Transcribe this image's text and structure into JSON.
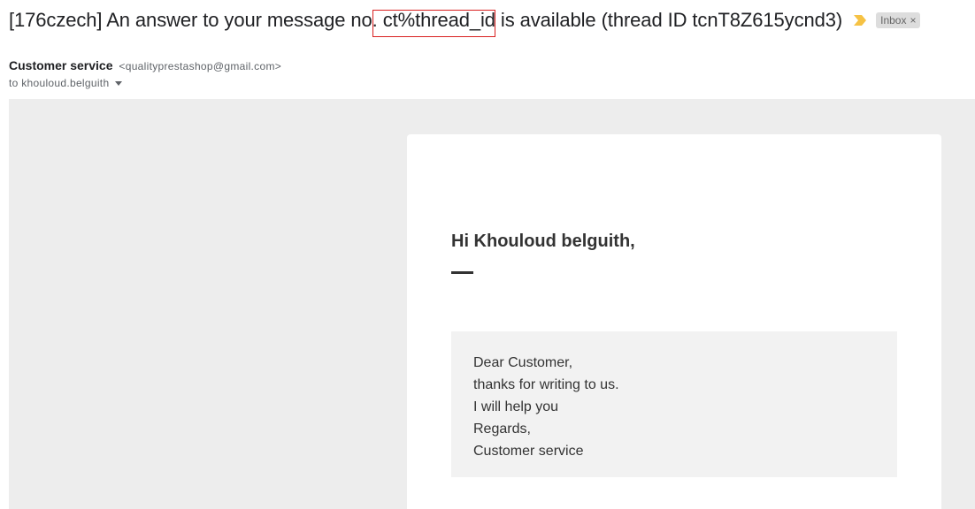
{
  "header": {
    "subject": "[176czech] An answer to your message no. ct%thread_id is available (thread ID tcnT8Z615ycnd3)",
    "important_icon": "important-marker-icon",
    "label": "Inbox",
    "label_remove": "×",
    "colors": {
      "highlight_border": "#d92020",
      "important_marker": "#f6c244",
      "label_bg": "#dddddd"
    }
  },
  "sender": {
    "name": "Customer service",
    "email": "<qualityprestashop@gmail.com>",
    "to": "to khouloud.belguith"
  },
  "body": {
    "greeting": "Hi Khouloud belguith,",
    "message_lines": [
      "Dear Customer,",
      "thanks for writing to us.",
      "I will help you",
      "Regards,",
      "Customer service"
    ],
    "colors": {
      "outer_bg": "#ededed",
      "card_bg": "#ffffff",
      "message_bg": "#f2f2f2",
      "text": "#333333"
    }
  }
}
